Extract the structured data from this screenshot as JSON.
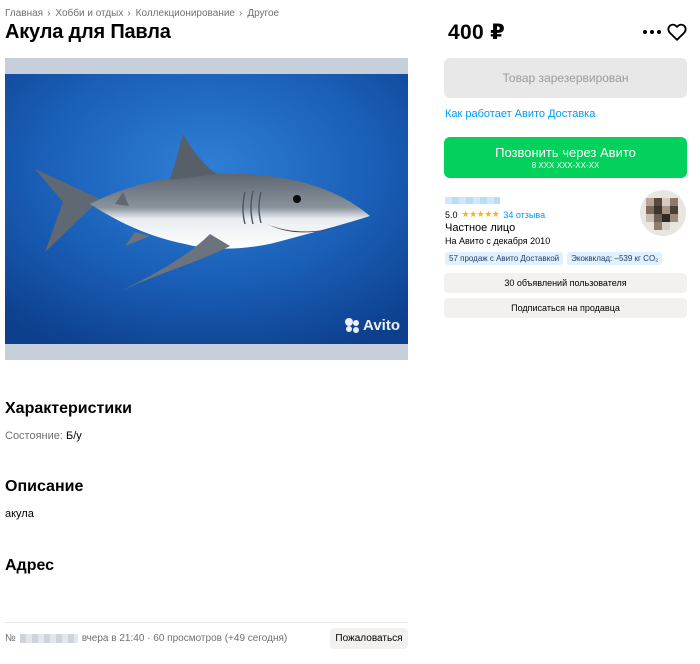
{
  "breadcrumbs": [
    "Главная",
    "Хобби и отдых",
    "Коллекционирование",
    "Другое"
  ],
  "title": "Акула для Павла",
  "gallery": {
    "watermark": "Avito"
  },
  "characteristics": {
    "heading": "Характеристики",
    "items": [
      {
        "label": "Состояние:",
        "value": "Б/у"
      }
    ]
  },
  "description": {
    "heading": "Описание",
    "text": "акула"
  },
  "address": {
    "heading": "Адрес"
  },
  "footer": {
    "number_prefix": "№",
    "meta": "вчера в 21:40 · 60 просмотров (+49 сегодня)",
    "complain_label": "Пожаловаться"
  },
  "sidebar": {
    "price": "400 ₽",
    "reserved_label": "Товар зарезервирован",
    "delivery_link": "Как работает Авито Доставка",
    "call_button": {
      "label": "Позвонить через Авито",
      "phone": "8 ХХХ ХХХ-ХХ-ХХ"
    },
    "seller": {
      "rating": "5.0",
      "stars": "★★★★★",
      "reviews": "34 отзыва",
      "type": "Частное лицо",
      "since": "На Авито с декабря 2010",
      "badges": [
        "57 продаж с Авито Доставкой",
        "Экоквклад: –539 кг CO₂"
      ]
    },
    "all_ads_label": "30 объявлений пользователя",
    "subscribe_label": "Подписаться на продавца"
  },
  "colors": {
    "accent_green": "#02d15c",
    "link_blue": "#0099f7",
    "star": "#ffb021"
  },
  "icons": {
    "more": "more-dots-icon",
    "favorite": "heart-icon"
  }
}
